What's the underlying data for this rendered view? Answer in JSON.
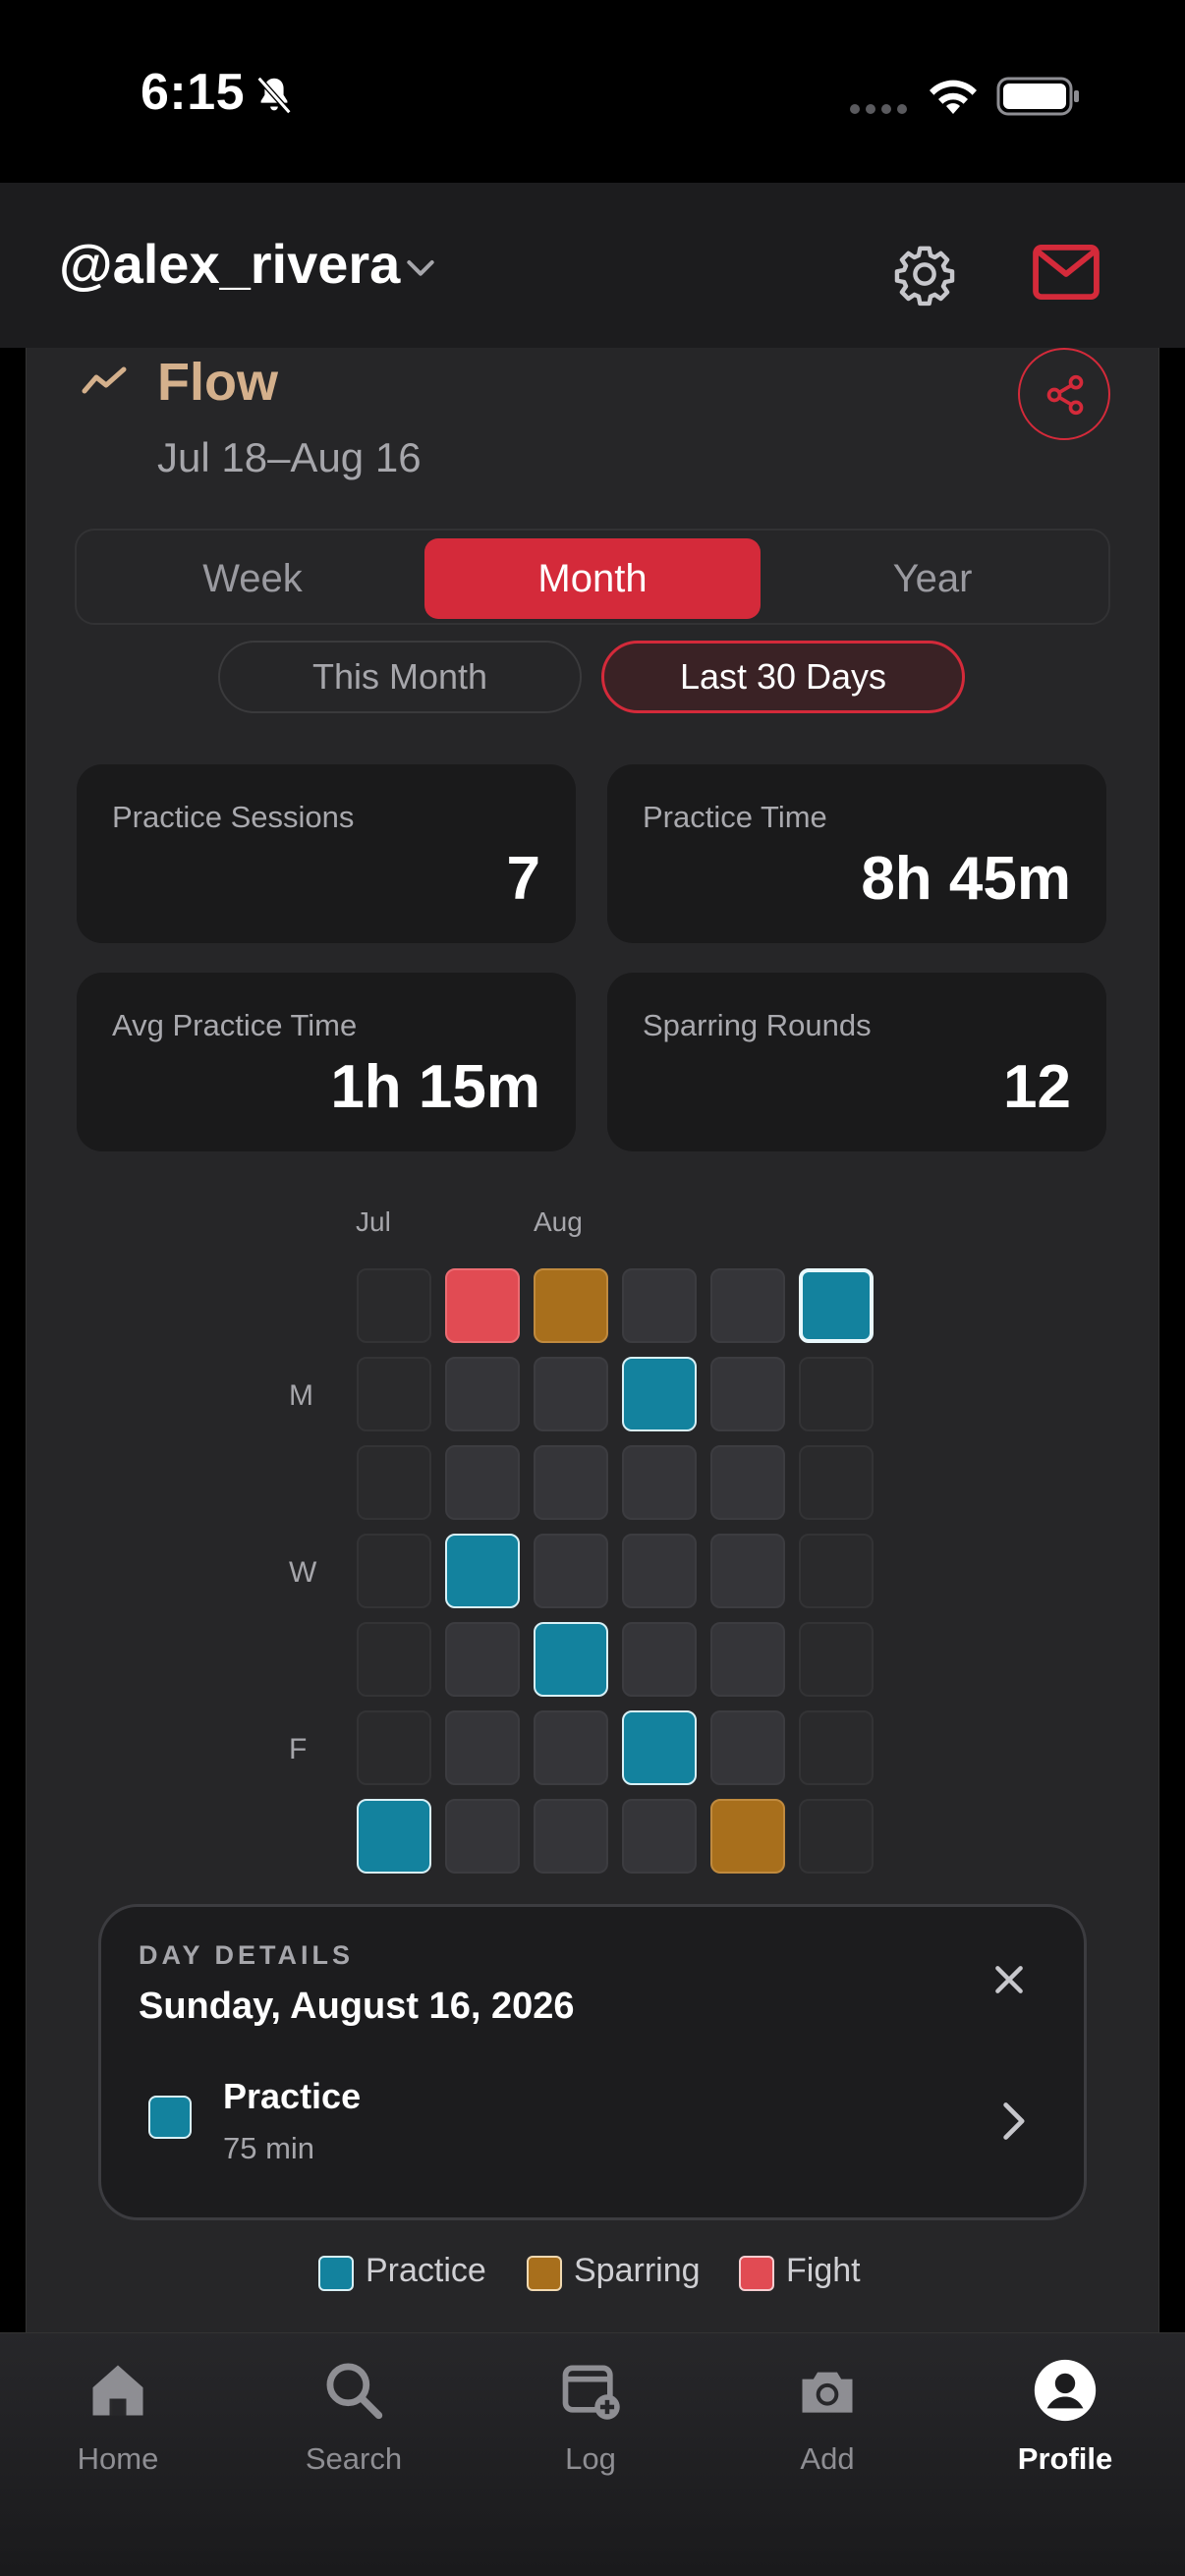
{
  "status_bar": {
    "time": "6:15"
  },
  "header": {
    "username": "@alex_rivera"
  },
  "flow": {
    "title": "Flow",
    "date_range": "Jul 18–Aug 16"
  },
  "range_tabs": {
    "week": "Week",
    "month": "Month",
    "year": "Year",
    "selected": "Month"
  },
  "sub_ranges": {
    "this_month": "This Month",
    "last_30_days": "Last 30 Days",
    "selected": "Last 30 Days"
  },
  "stats": {
    "sessions": {
      "label": "Practice Sessions",
      "value": "7"
    },
    "time": {
      "label": "Practice Time",
      "value": "8h 45m"
    },
    "avg": {
      "label": "Avg Practice Time",
      "value": "1h 15m"
    },
    "sparring": {
      "label": "Sparring Rounds",
      "value": "12"
    }
  },
  "heatmap": {
    "months": [
      "Jul",
      "Aug"
    ],
    "day_labels": {
      "mon": "M",
      "wed": "W",
      "fri": "F"
    },
    "grid_rows_sun_to_sat": [
      [
        "out",
        "fight",
        "sparring",
        "empty",
        "empty",
        "practice-selected"
      ],
      [
        "out",
        "empty",
        "empty",
        "practice",
        "empty",
        "out"
      ],
      [
        "out",
        "empty",
        "empty",
        "empty",
        "empty",
        "out"
      ],
      [
        "out",
        "practice",
        "empty",
        "empty",
        "empty",
        "out"
      ],
      [
        "out",
        "empty",
        "practice",
        "empty",
        "empty",
        "out"
      ],
      [
        "out",
        "empty",
        "empty",
        "practice",
        "empty",
        "out"
      ],
      [
        "practice",
        "empty",
        "empty",
        "empty",
        "sparring",
        "out"
      ]
    ]
  },
  "day_details": {
    "kicker": "DAY DETAILS",
    "date": "Sunday, August 16, 2026",
    "entry": {
      "title": "Practice",
      "subtitle": "75 min"
    }
  },
  "legend": {
    "practice": "Practice",
    "sparring": "Sparring",
    "fight": "Fight"
  },
  "colors": {
    "accent": "#d42a3a",
    "practice": "#13829e",
    "sparring": "#a86f1c",
    "fight": "#e14b53",
    "flow_title": "#d4b08c"
  },
  "tabbar": {
    "home": "Home",
    "search": "Search",
    "log": "Log",
    "add": "Add",
    "profile": "Profile",
    "active": "Profile"
  }
}
